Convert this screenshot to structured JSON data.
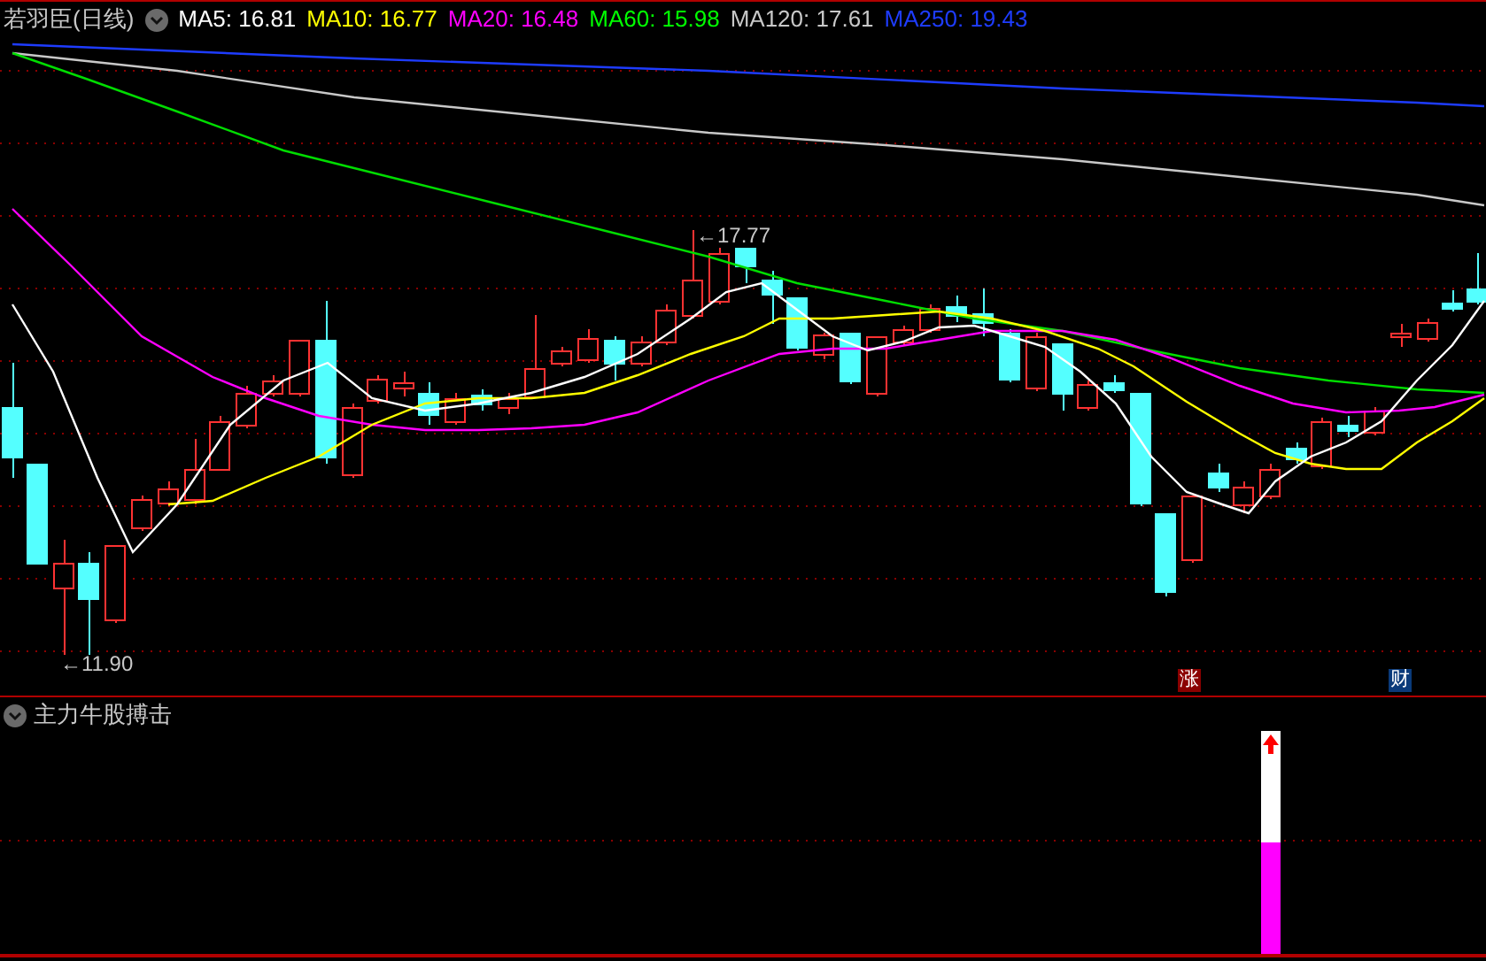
{
  "header": {
    "title": "若羽臣(日线)",
    "legend": [
      {
        "label": "MA5: 16.81",
        "color": "#ffffff"
      },
      {
        "label": "MA10: 16.77",
        "color": "#ffff00"
      },
      {
        "label": "MA20: 16.48",
        "color": "#ff00ff"
      },
      {
        "label": "MA60: 15.98",
        "color": "#00ff00"
      },
      {
        "label": "MA120: 17.61",
        "color": "#c8c8c8"
      },
      {
        "label": "MA250: 19.43",
        "color": "#1e3cff"
      }
    ]
  },
  "price_labels": [
    {
      "kind": "high",
      "text": "←17.77"
    },
    {
      "kind": "low",
      "text": "←11.90"
    }
  ],
  "markers": [
    {
      "text": "涨",
      "color": "#8b0000"
    },
    {
      "text": "财",
      "color": "#0a3a7a"
    }
  ],
  "indicator": {
    "title": "主力牛股搏击"
  }
}
